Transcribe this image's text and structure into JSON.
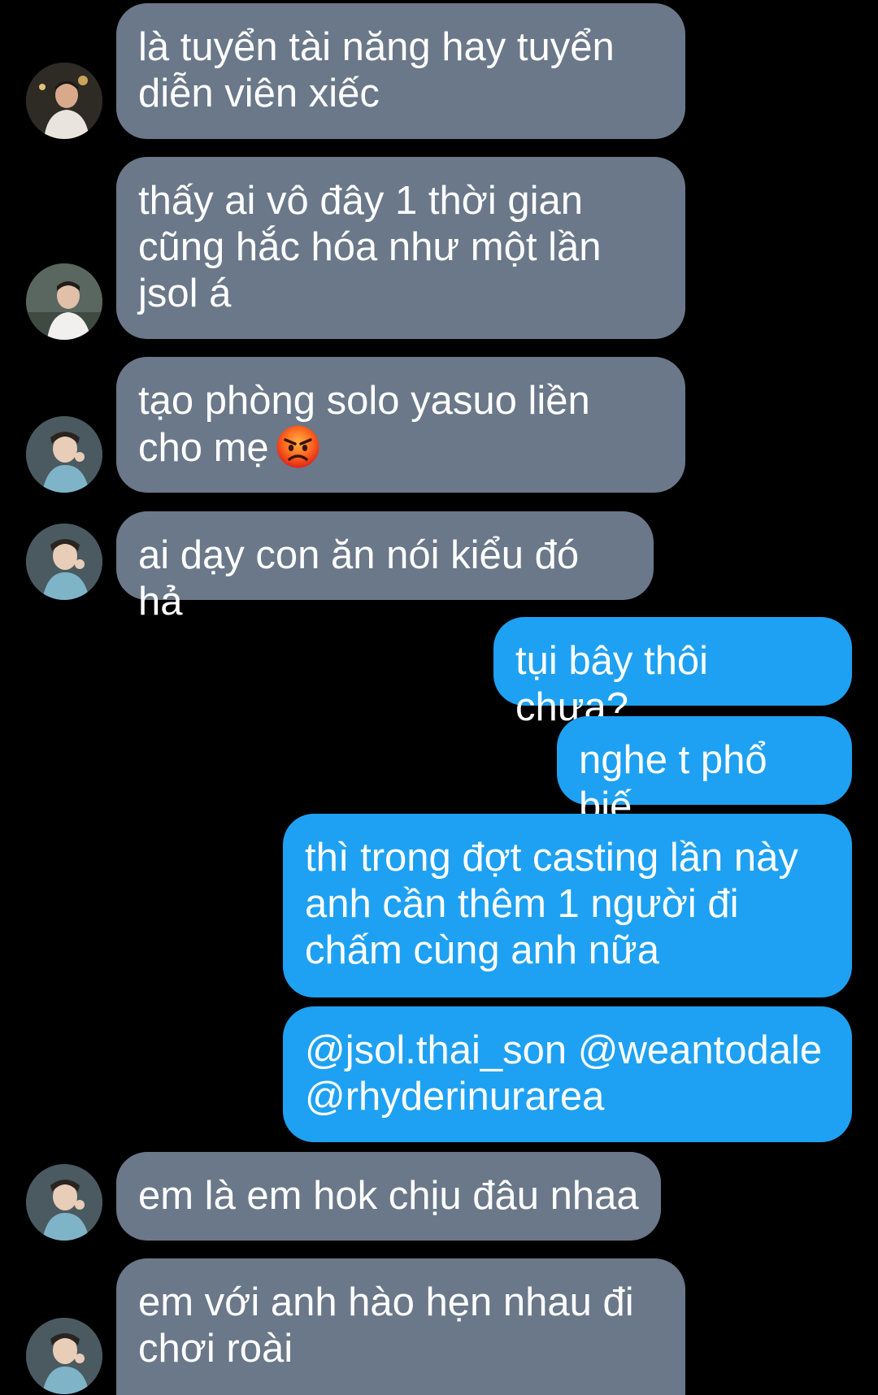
{
  "messages": [
    {
      "sender": "other",
      "text": "là tuyển tài năng hay tuyển diễn viên xiếc"
    },
    {
      "sender": "other",
      "text": "thấy ai vô đây 1 thời gian cũng hắc hóa như một lần jsol á"
    },
    {
      "sender": "other",
      "text": "tạo phòng solo yasuo liền cho mẹ",
      "emoji": "angry-face"
    },
    {
      "sender": "other",
      "text": "ai dạy con ăn nói kiểu đó hả"
    },
    {
      "sender": "me",
      "text": "tụi bây thôi chưa?"
    },
    {
      "sender": "me",
      "text": "nghe t phổ biế"
    },
    {
      "sender": "me",
      "text": "thì trong đợt casting lần này anh cần thêm 1 người đi chấm cùng anh nữa"
    },
    {
      "sender": "me",
      "text": "@jsol.thai_son @weantodale @rhyderinurarea"
    },
    {
      "sender": "other",
      "text": "em là em hok chịu đâu nhaa"
    },
    {
      "sender": "other",
      "text": "em với anh hào hẹn nhau đi chơi roài"
    }
  ],
  "colors": {
    "background": "#000000",
    "incoming_bubble": "#6a7889",
    "outgoing_bubble": "#1ea1f2",
    "text": "#ffffff"
  }
}
